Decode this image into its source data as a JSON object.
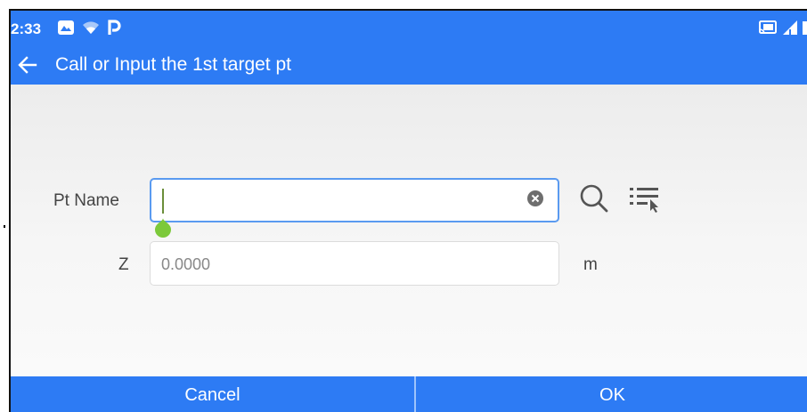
{
  "status_bar": {
    "time": "2:33",
    "icons": [
      "gallery-icon",
      "wifi-icon",
      "parking-icon",
      "cast-icon",
      "signal-icon",
      "battery-icon"
    ]
  },
  "header": {
    "title": "Call or Input the 1st target pt",
    "back_icon": "arrow-left-icon"
  },
  "form": {
    "pt_name": {
      "label": "Pt Name",
      "value": "",
      "placeholder": ""
    },
    "z": {
      "label": "Z",
      "value": "",
      "placeholder": "0.0000",
      "unit": "m"
    }
  },
  "footer": {
    "cancel_label": "Cancel",
    "ok_label": "OK"
  },
  "colors": {
    "accent": "#2d7bf4",
    "focus_border": "#5a9af0",
    "cursor_handle": "#7cc93a"
  }
}
